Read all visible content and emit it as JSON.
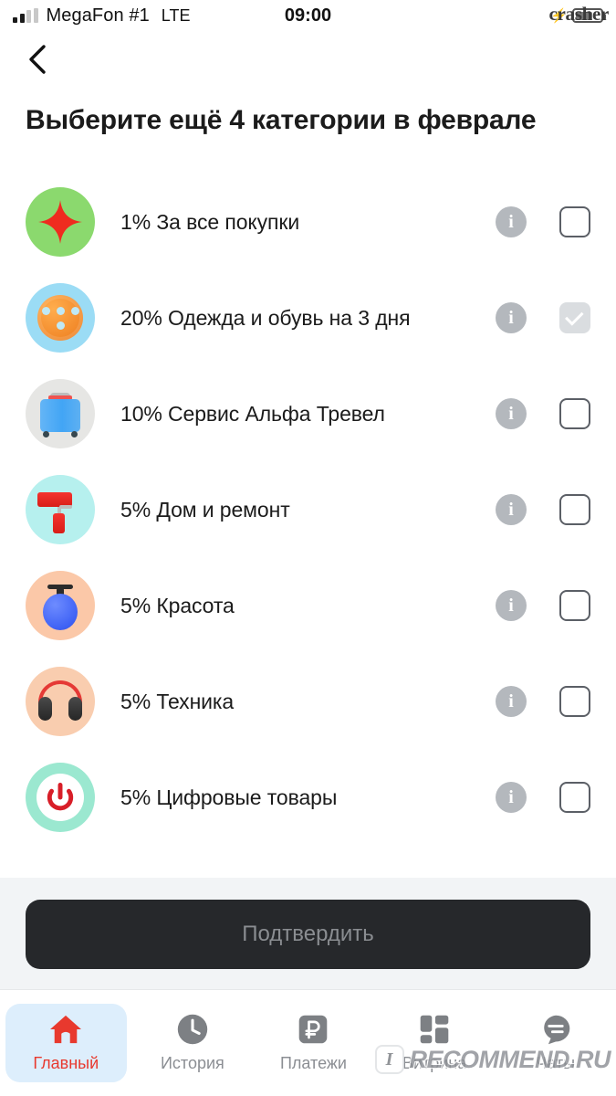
{
  "status_bar": {
    "carrier": "MegaFon #1",
    "network": "LTE",
    "time": "09:00",
    "signal_icon": "signal-bars-icon",
    "battery_icon": "battery-icon",
    "charging_icon": "lightning-bolt-icon"
  },
  "watermarks": {
    "top_right": "crasher",
    "bottom_badge": "I",
    "bottom_text": "RECOMMEND.RU"
  },
  "header": {
    "back_icon": "chevron-left-icon",
    "title": "Выберите ещё 4 категории в феврале"
  },
  "categories": [
    {
      "label": "1% За все покупки",
      "percent": "1%",
      "name": "За все покупки",
      "icon": "red-star-icon",
      "icon_bg": "#8BD96E",
      "checked": false,
      "disabled": false,
      "info_icon": "info-icon"
    },
    {
      "label": "20% Одежда и обувь на 3 дня",
      "percent": "20%",
      "name": "Одежда и обувь на 3 дня",
      "icon": "sewing-button-icon",
      "icon_bg": "#9BDCF5",
      "checked": true,
      "disabled": true,
      "info_icon": "info-icon"
    },
    {
      "label": "10% Сервис Альфа Тревел",
      "percent": "10%",
      "name": "Сервис Альфа Тревел",
      "icon": "suitcase-icon",
      "icon_bg": "#E6E6E4",
      "checked": false,
      "disabled": false,
      "info_icon": "info-icon"
    },
    {
      "label": "5% Дом и ремонт",
      "percent": "5%",
      "name": "Дом и ремонт",
      "icon": "paint-roller-icon",
      "icon_bg": "#B6F0EE",
      "checked": false,
      "disabled": false,
      "info_icon": "info-icon"
    },
    {
      "label": "5% Красота",
      "percent": "5%",
      "name": "Красота",
      "icon": "soap-dispenser-icon",
      "icon_bg": "#FBC8A8",
      "checked": false,
      "disabled": false,
      "info_icon": "info-icon"
    },
    {
      "label": "5% Техника",
      "percent": "5%",
      "name": "Техника",
      "icon": "headphones-icon",
      "icon_bg": "#F9CDAF",
      "checked": false,
      "disabled": false,
      "info_icon": "info-icon"
    },
    {
      "label": "5% Цифровые товары",
      "percent": "5%",
      "name": "Цифровые товары",
      "icon": "power-button-icon",
      "icon_bg": "#9BE8D0",
      "checked": false,
      "disabled": false,
      "info_icon": "info-icon"
    }
  ],
  "footer": {
    "confirm_label": "Подтвердить",
    "confirm_enabled": false,
    "confirm_bg": "#26282B",
    "confirm_text_color": "#8A8D91"
  },
  "tabbar": {
    "active_index": 0,
    "active_color": "#E8392E",
    "active_bg": "#DDEEFC",
    "items": [
      {
        "label": "Главный",
        "icon": "home-icon"
      },
      {
        "label": "История",
        "icon": "clock-icon"
      },
      {
        "label": "Платежи",
        "icon": "ruble-icon"
      },
      {
        "label": "Витрина",
        "icon": "grid-icon"
      },
      {
        "label": "Чаты",
        "icon": "chat-bubble-icon"
      }
    ]
  }
}
